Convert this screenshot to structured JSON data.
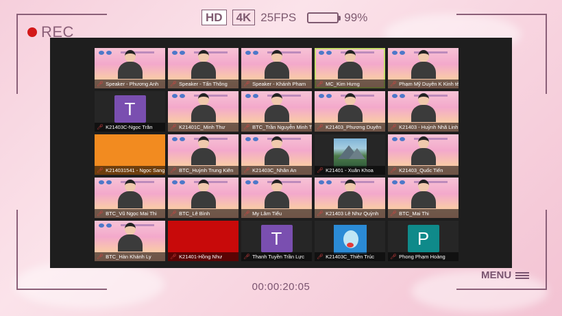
{
  "overlay": {
    "rec_label": "REC",
    "badges": {
      "hd": "HD",
      "k": "4K",
      "fps": "25FPS"
    },
    "battery_label": "99%",
    "battery_level": 0.99,
    "timer": "00:00:20:05",
    "menu_label": "MENU"
  },
  "colors": {
    "rec_dot": "#d31919",
    "battery": "#6cc23a",
    "active_speaker_border": "#c8de6c",
    "mic_muted": "#e04242"
  },
  "participants": [
    {
      "name": "Speaker - Phương Anh",
      "type": "video"
    },
    {
      "name": "Speaker - Tấn Thông",
      "type": "video"
    },
    {
      "name": "Speaker - Khánh Pham",
      "type": "video"
    },
    {
      "name": "MC_Kim Hưng",
      "type": "video",
      "active": true
    },
    {
      "name": "Phạm Mỹ Duyên K Kinh tế",
      "type": "video"
    },
    {
      "name": "K21403C-Ngọc Trân",
      "type": "avatar",
      "initial": "T",
      "color": "#7a4fb0"
    },
    {
      "name": "K21401C_Minh Thư",
      "type": "video"
    },
    {
      "name": "BTC_Trần Nguyễn Minh T...",
      "type": "video"
    },
    {
      "name": "K21403_Phương Duyên",
      "type": "video"
    },
    {
      "name": "K21403 - Huỳnh Nhã Linh",
      "type": "video"
    },
    {
      "name": "K214031541 - Ngọc Sang",
      "type": "color",
      "color": "#f28b20"
    },
    {
      "name": "BTC_Huỳnh Trung Kiên",
      "type": "video"
    },
    {
      "name": "K21403C_Nhân An",
      "type": "video"
    },
    {
      "name": "K21401 - Xuân Khoa",
      "type": "picture",
      "picture": "mountain"
    },
    {
      "name": "K21403_Quốc Tiến",
      "type": "video"
    },
    {
      "name": "BTC_Vũ Ngọc Mai Thi",
      "type": "video"
    },
    {
      "name": "BTC_Lê Bình",
      "type": "video"
    },
    {
      "name": "My Lâm Tiểu",
      "type": "video"
    },
    {
      "name": "K21403 Lê Như Quỳnh",
      "type": "video"
    },
    {
      "name": "BTC_Mai Thi",
      "type": "video"
    },
    {
      "name": "BTC_Hàn Khánh Ly",
      "type": "video"
    },
    {
      "name": "K21401-Hồng Như",
      "type": "color",
      "color": "#c80a0a"
    },
    {
      "name": "Thanh Tuyền Trần Lực",
      "type": "avatar",
      "initial": "T",
      "color": "#7a4fb0"
    },
    {
      "name": "K21403C_Thiên Trúc",
      "type": "picture",
      "picture": "cartoon"
    },
    {
      "name": "Phong Phạm Hoàng",
      "type": "avatar",
      "initial": "P",
      "color": "#0f8a8a"
    }
  ]
}
